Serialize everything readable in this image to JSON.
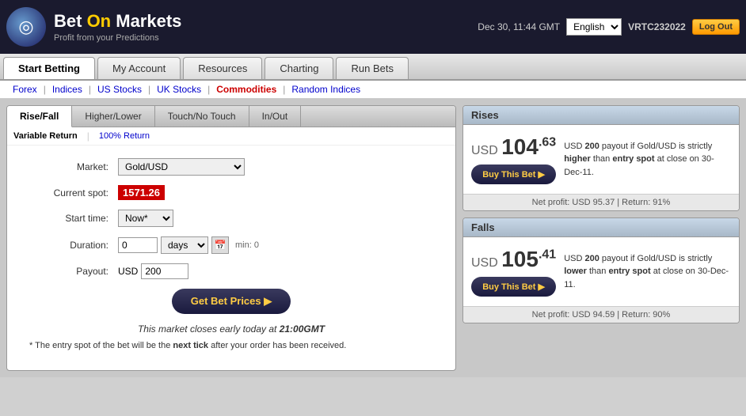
{
  "topbar": {
    "logo_letter": "◎",
    "brand_pre": "Bet ",
    "brand_on": "On",
    "brand_post": " Markets",
    "tagline": "Profit from your Predictions",
    "datetime": "Dec 30, 11:44 GMT",
    "language": "English",
    "username": "VRTC232022",
    "logout_label": "Log Out"
  },
  "nav": {
    "tabs": [
      {
        "label": "Start Betting",
        "active": true
      },
      {
        "label": "My Account",
        "active": false
      },
      {
        "label": "Resources",
        "active": false
      },
      {
        "label": "Charting",
        "active": false
      },
      {
        "label": "Run Bets",
        "active": false
      }
    ]
  },
  "subnav": {
    "items": [
      {
        "label": "Forex",
        "active": false
      },
      {
        "label": "Indices",
        "active": false
      },
      {
        "label": "US Stocks",
        "active": false
      },
      {
        "label": "UK Stocks",
        "active": false
      },
      {
        "label": "Commodities",
        "active": true
      },
      {
        "label": "Random Indices",
        "active": false
      }
    ]
  },
  "bet_tabs": [
    {
      "label": "Rise/Fall",
      "active": true
    },
    {
      "label": "Higher/Lower",
      "active": false
    },
    {
      "label": "Touch/No Touch",
      "active": false
    },
    {
      "label": "In/Out",
      "active": false
    }
  ],
  "return_tabs": [
    {
      "label": "Variable Return",
      "active": true
    },
    {
      "label": "100% Return",
      "active": false
    }
  ],
  "form": {
    "market_label": "Market:",
    "market_value": "Gold/USD",
    "spot_label": "Current spot:",
    "spot_value": "1571.26",
    "start_label": "Start time:",
    "start_value": "Now*",
    "duration_label": "Duration:",
    "duration_value": "0",
    "days_value": "days",
    "min_label": "min: 0",
    "payout_label": "Payout:",
    "payout_currency": "USD",
    "payout_value": "200",
    "get_bet_label": "Get Bet Prices ▶",
    "close_notice": "This market closes early today at 21:00GMT",
    "entry_note": "* The entry spot of the bet will be the next tick after your order has been received."
  },
  "rises": {
    "header": "Rises",
    "amount_currency": "USD",
    "amount_main": "104",
    "amount_sup": "63",
    "description_pre": "USD ",
    "description_amount": "200",
    "description_text": " payout if Gold/USD is strictly ",
    "description_strong": "higher",
    "description_text2": " than ",
    "description_strong2": "entry spot",
    "description_text3": " at close on 30-Dec-11.",
    "buy_label": "Buy This Bet ▶",
    "footer": "Net profit: USD 95.37 | Return: 91%"
  },
  "falls": {
    "header": "Falls",
    "amount_currency": "USD",
    "amount_main": "105",
    "amount_sup": "41",
    "description_pre": "USD ",
    "description_amount": "200",
    "description_text": " payout if Gold/USD is strictly ",
    "description_strong": "lower",
    "description_text2": " than ",
    "description_strong2": "entry spot",
    "description_text3": " at close on 30-Dec-11.",
    "buy_label": "Buy This Bet ▶",
    "footer": "Net profit: USD 94.59 | Return: 90%"
  }
}
